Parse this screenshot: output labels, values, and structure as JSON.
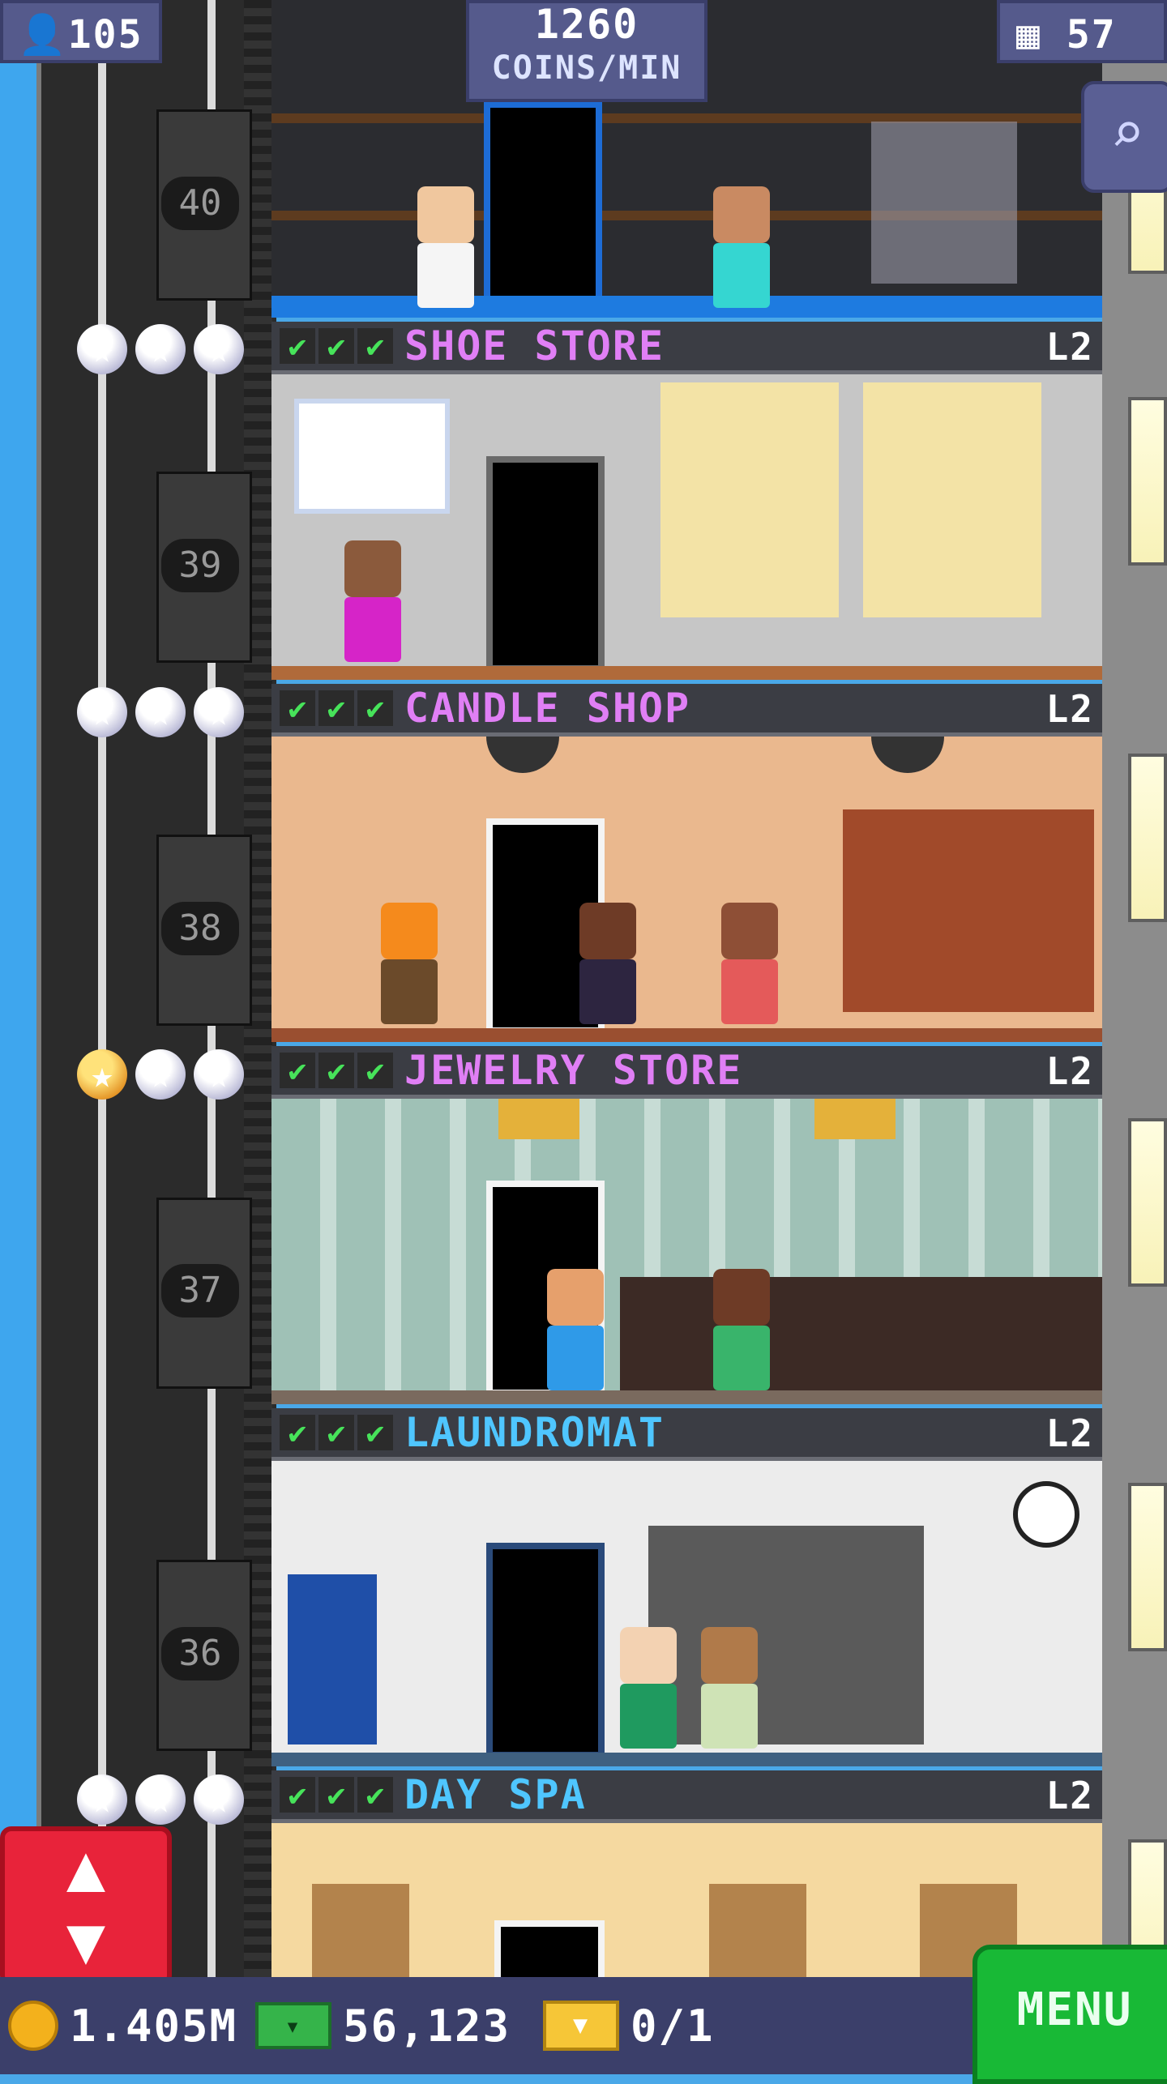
{
  "hud": {
    "population": "105",
    "coins_per_min_value": "1260",
    "coins_per_min_label": "COINS/MIN",
    "floor_count": "57"
  },
  "shaft_floors": [
    "40",
    "39",
    "38",
    "37",
    "36"
  ],
  "floors": [
    {
      "name": "SHOE STORE",
      "level": "L2",
      "name_color": "#e07ff5",
      "checks": "3"
    },
    {
      "name": "CANDLE SHOP",
      "level": "L2",
      "name_color": "#e07ff5",
      "checks": "3"
    },
    {
      "name": "JEWELRY STORE",
      "level": "L2",
      "name_color": "#e07ff5",
      "checks": "3"
    },
    {
      "name": "LAUNDROMAT",
      "level": "L2",
      "name_color": "#4fc6ff",
      "checks": "3"
    },
    {
      "name": "DAY SPA",
      "level": "L2",
      "name_color": "#4fc6ff",
      "checks": "3"
    }
  ],
  "bottom": {
    "coins": "1.405M",
    "bux": "56,123",
    "tickets": "0/1",
    "menu_label": "MENU"
  },
  "icons": {
    "population": "person-icon",
    "floors": "building-icon",
    "zoom": "zoom-out-icon",
    "elevator": "elevator-up-down-icon",
    "coin": "coin-icon",
    "bux": "bux-icon",
    "ticket": "ticket-icon",
    "check": "check-icon",
    "star": "star-icon"
  }
}
